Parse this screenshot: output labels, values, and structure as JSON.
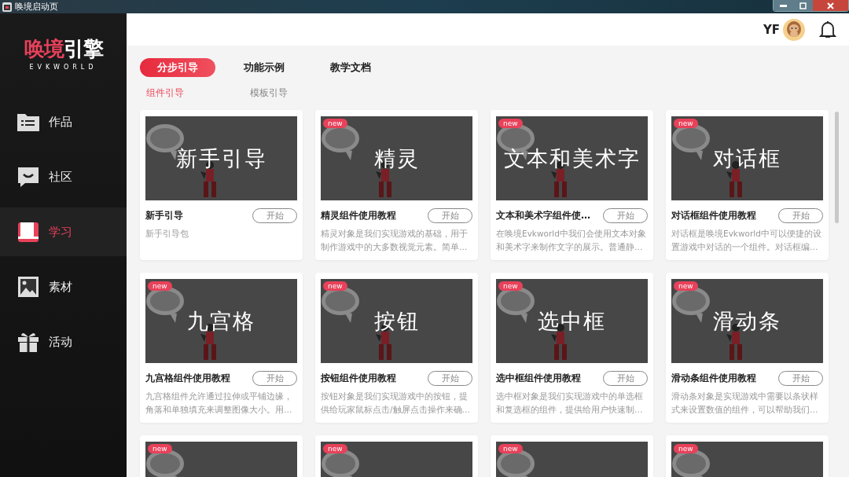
{
  "window": {
    "title": "唤境启动页"
  },
  "logo": {
    "part1": "唤境",
    "part2": "引擎",
    "subtitle": "EVKWORLD"
  },
  "sidebar": {
    "items": [
      {
        "label": "作品",
        "selected": false
      },
      {
        "label": "社区",
        "selected": false
      },
      {
        "label": "学习",
        "selected": true
      },
      {
        "label": "素材",
        "selected": false
      },
      {
        "label": "活动",
        "selected": false
      }
    ]
  },
  "header": {
    "user": "YF"
  },
  "tabs": [
    {
      "label": "分步引导",
      "selected": true
    },
    {
      "label": "功能示例",
      "selected": false
    },
    {
      "label": "教学文档",
      "selected": false
    }
  ],
  "subtabs": [
    {
      "label": "组件引导",
      "selected": true
    },
    {
      "label": "模板引导",
      "selected": false
    }
  ],
  "cards": [
    {
      "thumb_text": "新手引导",
      "title": "新手引导",
      "button": "开始",
      "description": "新手引导包"
    },
    {
      "badge": "new",
      "thumb_text": "精灵",
      "title": "精灵组件使用教程",
      "button": "开始",
      "description": "精灵对象是我们实现游戏的基础，用于制作游戏中的大多数视觉元素。简单…"
    },
    {
      "badge": "new",
      "thumb_text": "文本和美术字",
      "title": "文本和美术字组件使…",
      "button": "开始",
      "description": "在唤境Evkworld中我们会使用文本对象和美术字来制作文字的展示。普通静…"
    },
    {
      "badge": "new",
      "thumb_text": "对话框",
      "title": "对话框组件使用教程",
      "button": "开始",
      "description": "对话框是唤境Evkworld中可以便捷的设置游戏中对话的一个组件。对话框编…"
    },
    {
      "badge": "new",
      "thumb_text": "九宫格",
      "title": "九宫格组件使用教程",
      "button": "开始",
      "description": "九宫格组件允许通过拉伸或平铺边缘，角落和单独填充来调整图像大小。用…"
    },
    {
      "badge": "new",
      "thumb_text": "按钮",
      "title": "按钮组件使用教程",
      "button": "开始",
      "description": "按钮对象是我们实现游戏中的按钮，提供给玩家鼠标点击/触屏点击操作来确…"
    },
    {
      "badge": "new",
      "thumb_text": "选中框",
      "title": "选中框组件使用教程",
      "button": "开始",
      "description": "选中框对象是我们实现游戏中的单选框和复选框的组件，提供给用户快速制…"
    },
    {
      "badge": "new",
      "thumb_text": "滑动条",
      "title": "滑动条组件使用教程",
      "button": "开始",
      "description": "滑动条对象是实现游戏中需要以条状样式来设置数值的组件，可以帮助我们…"
    },
    {
      "badge": "new"
    },
    {
      "badge": "new"
    },
    {
      "badge": "new"
    },
    {
      "badge": "new"
    }
  ]
}
